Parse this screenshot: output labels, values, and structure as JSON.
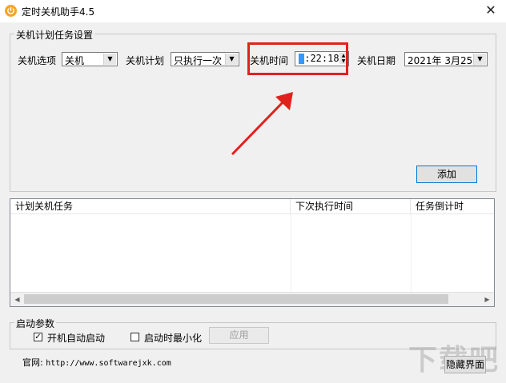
{
  "window": {
    "title": "定时关机助手4.5",
    "close_glyph": "✕"
  },
  "plan_group": {
    "title": "关机计划任务设置",
    "option_label": "关机选项",
    "option_value": "关机",
    "plan_label": "关机计划",
    "plan_value": "只执行一次",
    "time_label": "关机时间",
    "time_value": "0:22:18",
    "time_hour_digit": "0",
    "time_rest": ":22:18",
    "date_label": "关机日期",
    "date_value": "2021年 3月25日",
    "add_button": "添加"
  },
  "task_list": {
    "columns": [
      "计划关机任务",
      "下次执行时间",
      "任务倒计时"
    ],
    "rows": []
  },
  "startup_group": {
    "title": "启动参数",
    "autostart_label": "开机自动启动",
    "autostart_checked": true,
    "minimize_label": "启动时最小化",
    "minimize_checked": false,
    "apply_button": "应用"
  },
  "footer": {
    "site_label": "官网:",
    "site_url": "http://www.softwarejxk.com",
    "hide_button": "隐藏界面"
  },
  "annotation": {
    "highlight_color": "#e0221e"
  },
  "colors": {
    "accent": "#0078d7",
    "selection": "#3399ff",
    "icon": "#f5a623"
  },
  "icons": [
    "power-icon",
    "close-icon",
    "dropdown-arrow-icon",
    "spin-up-icon",
    "spin-down-icon",
    "checkmark-icon",
    "scroll-left-icon",
    "scroll-right-icon"
  ]
}
